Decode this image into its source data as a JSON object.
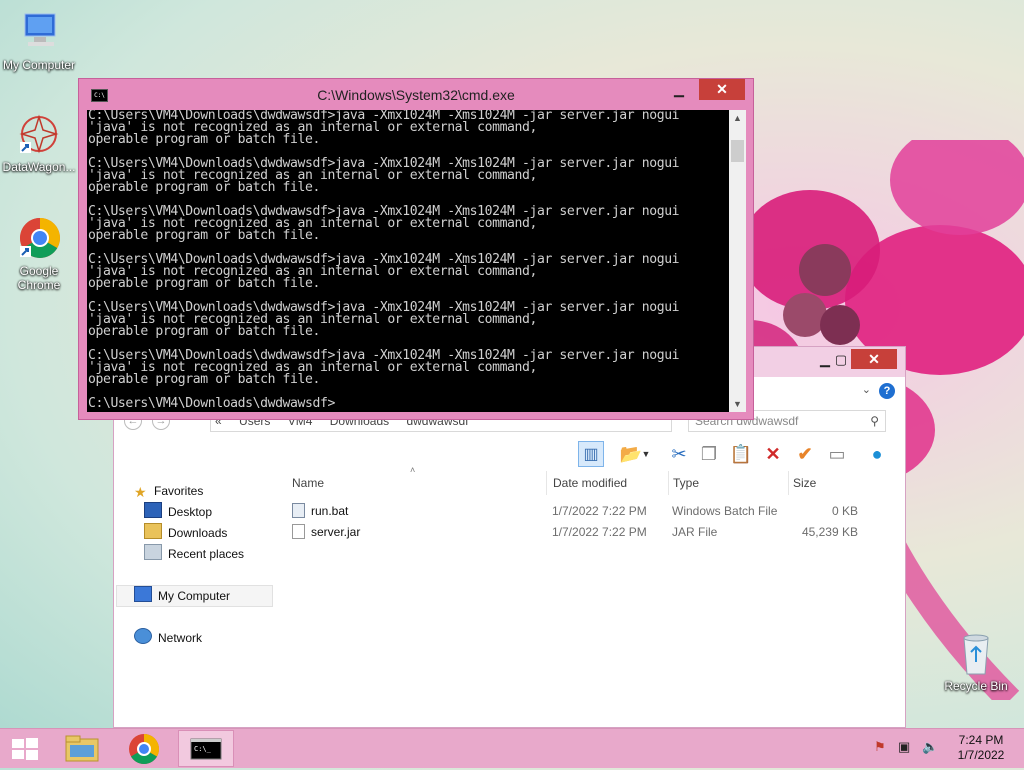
{
  "desktop": {
    "icons": [
      {
        "label": "My Computer"
      },
      {
        "label": "DataWagon..."
      },
      {
        "label": "Google Chrome"
      },
      {
        "label": "Recycle Bin"
      }
    ]
  },
  "cmd": {
    "title": "C:\\Windows\\System32\\cmd.exe",
    "icon_label": "C:\\",
    "lines": [
      "C:\\Users\\VM4\\Downloads\\dwdwawsdf>java -Xmx1024M -Xms1024M -jar server.jar nogui",
      "'java' is not recognized as an internal or external command,",
      "operable program or batch file.",
      "",
      "C:\\Users\\VM4\\Downloads\\dwdwawsdf>java -Xmx1024M -Xms1024M -jar server.jar nogui",
      "'java' is not recognized as an internal or external command,",
      "operable program or batch file.",
      "",
      "C:\\Users\\VM4\\Downloads\\dwdwawsdf>java -Xmx1024M -Xms1024M -jar server.jar nogui",
      "'java' is not recognized as an internal or external command,",
      "operable program or batch file.",
      "",
      "C:\\Users\\VM4\\Downloads\\dwdwawsdf>java -Xmx1024M -Xms1024M -jar server.jar nogui",
      "'java' is not recognized as an internal or external command,",
      "operable program or batch file.",
      "",
      "C:\\Users\\VM4\\Downloads\\dwdwawsdf>java -Xmx1024M -Xms1024M -jar server.jar nogui",
      "'java' is not recognized as an internal or external command,",
      "operable program or batch file.",
      "",
      "C:\\Users\\VM4\\Downloads\\dwdwawsdf>java -Xmx1024M -Xms1024M -jar server.jar nogui",
      "'java' is not recognized as an internal or external command,",
      "operable program or batch file.",
      "",
      "C:\\Users\\VM4\\Downloads\\dwdwawsdf>"
    ]
  },
  "explorer": {
    "address": [
      "«",
      "Users",
      "VM4",
      "Downloads",
      "dwdwawsdf"
    ],
    "search_placeholder": "Search dwdwawsdf",
    "nav": {
      "favorites": "Favorites",
      "desktop": "Desktop",
      "downloads": "Downloads",
      "recent": "Recent places",
      "computer": "My Computer",
      "network": "Network"
    },
    "columns": {
      "name": "Name",
      "date": "Date modified",
      "type": "Type",
      "size": "Size"
    },
    "files": [
      {
        "name": "run.bat",
        "date": "1/7/2022 7:22 PM",
        "type": "Windows Batch File",
        "size": "0 KB"
      },
      {
        "name": "server.jar",
        "date": "1/7/2022 7:22 PM",
        "type": "JAR File",
        "size": "45,239 KB"
      }
    ]
  },
  "taskbar": {
    "time": "7:24 PM",
    "date": "1/7/2022"
  }
}
